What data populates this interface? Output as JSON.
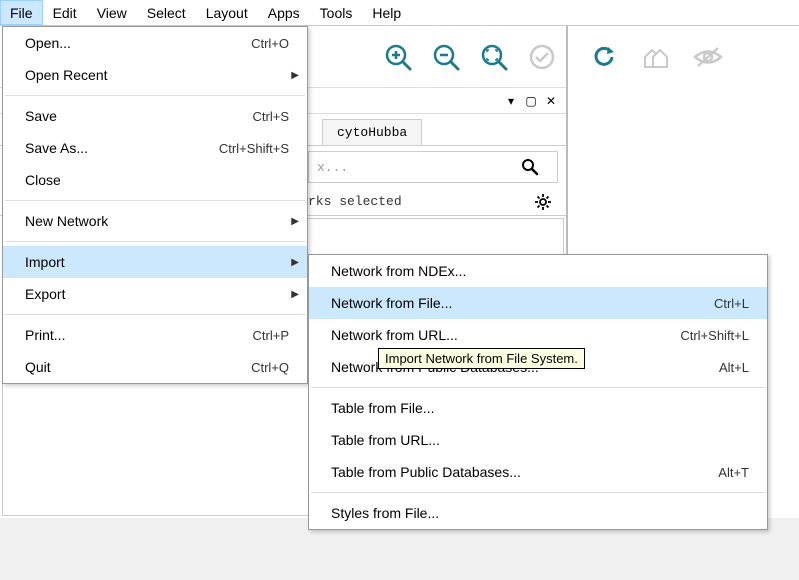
{
  "menubar": [
    "File",
    "Edit",
    "View",
    "Select",
    "Layout",
    "Apps",
    "Tools",
    "Help"
  ],
  "menubar_active_index": 0,
  "file_menu": {
    "open": {
      "label": "Open...",
      "shortcut": "Ctrl+O"
    },
    "open_recent": {
      "label": "Open Recent"
    },
    "save": {
      "label": "Save",
      "shortcut": "Ctrl+S"
    },
    "save_as": {
      "label": "Save As...",
      "shortcut": "Ctrl+Shift+S"
    },
    "close": {
      "label": "Close"
    },
    "new_network": {
      "label": "New Network"
    },
    "import": {
      "label": "Import"
    },
    "export": {
      "label": "Export"
    },
    "print": {
      "label": "Print...",
      "shortcut": "Ctrl+P"
    },
    "quit": {
      "label": "Quit",
      "shortcut": "Ctrl+Q"
    }
  },
  "import_menu": {
    "ndex": {
      "label": "Network from NDEx..."
    },
    "file": {
      "label": "Network from File...",
      "shortcut": "Ctrl+L"
    },
    "url": {
      "label": "Network from URL...",
      "shortcut": "Ctrl+Shift+L"
    },
    "public": {
      "label": "Network from Public Databases...",
      "shortcut": "Alt+L"
    },
    "table_file": {
      "label": "Table from File..."
    },
    "table_url": {
      "label": "Table from URL..."
    },
    "table_public": {
      "label": "Table from Public Databases...",
      "shortcut": "Alt+T"
    },
    "styles": {
      "label": "Styles from File..."
    }
  },
  "tooltip": "Import Network from File System.",
  "tabs": {
    "cytohubba": "cytoHubba"
  },
  "search": {
    "placeholder_fragment": "x..."
  },
  "status": {
    "text_fragment": "rks selected"
  },
  "colors": {
    "highlight": "#cce8ff",
    "icon_teal": "#1b7a8c",
    "icon_gray": "#888"
  }
}
